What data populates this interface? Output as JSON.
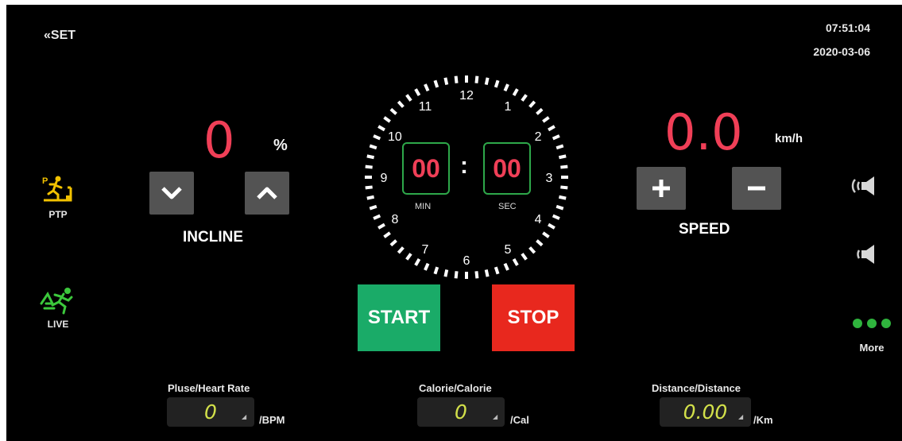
{
  "header": {
    "set_label": "SET",
    "time": "07:51:04",
    "date": "2020-03-06"
  },
  "sidebar_left": [
    {
      "label": "PTP",
      "icon": "ptp-treadmill-icon",
      "color": "#f2c200"
    },
    {
      "label": "LIVE",
      "icon": "live-runner-icon",
      "color": "#3cc83c"
    }
  ],
  "incline": {
    "value": "0",
    "unit": "%",
    "label": "INCLINE"
  },
  "timer": {
    "minutes": "00",
    "seconds": "00",
    "separator": ":",
    "min_label": "MIN",
    "sec_label": "SEC",
    "dial_numbers": [
      "12",
      "1",
      "2",
      "3",
      "4",
      "5",
      "6",
      "7",
      "8",
      "9",
      "10",
      "11"
    ]
  },
  "speed": {
    "value": "0.0",
    "unit": "km/h",
    "label": "SPEED"
  },
  "controls": {
    "start_label": "START",
    "stop_label": "STOP",
    "start_color": "#1aab68",
    "stop_color": "#e8281e"
  },
  "sidebar_right": {
    "more_label": "More"
  },
  "stats": [
    {
      "title": "Pluse/Heart Rate",
      "value": "0",
      "unit": "/BPM"
    },
    {
      "title": "Calorie/Calorie",
      "value": "0",
      "unit": "/Cal"
    },
    {
      "title": "Distance/Distance",
      "value": "0.00",
      "unit": "/Km"
    }
  ],
  "colors": {
    "accent_red": "#f03f57",
    "value_yellow": "#d2e04a",
    "timer_border": "#2ea84a",
    "button_gray": "#535353"
  }
}
